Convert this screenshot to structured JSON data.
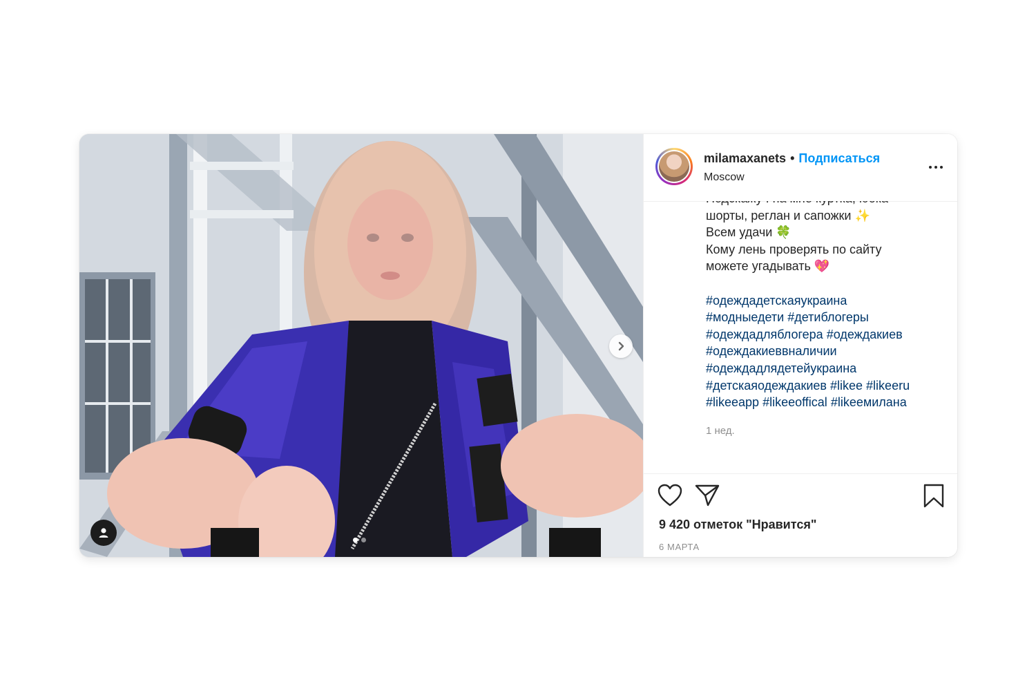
{
  "post": {
    "user": {
      "username": "milamaxanets",
      "follow_label": "Подписаться",
      "location": "Moscow",
      "separator": "•"
    },
    "caption_lines": [
      "Подскажу : на мне куртка, юбка",
      "шорты, реглан и сапожки ✨",
      "Всем удачи 🍀",
      "Кому лень проверять по сайту",
      "можете угадывать 💖"
    ],
    "hashtag_lines": [
      [
        "#одеждадетскаяукраина"
      ],
      [
        "#модныедети",
        "#детиблогеры"
      ],
      [
        "#одеждадляблогера",
        "#одеждакиев"
      ],
      [
        "#одеждакиеввналичии"
      ],
      [
        "#одеждадлядетейукраина"
      ],
      [
        "#детскаяодеждакиев",
        "#likee",
        "#likeeru"
      ],
      [
        "#likeeapp",
        "#likeeoffical",
        "#likeeмилана"
      ]
    ],
    "time_ago": "1 нед.",
    "likes": "9 420 отметок \"Нравится\"",
    "date": "6 МАРТА",
    "carousel": {
      "total": 2,
      "active": 1
    }
  },
  "icons": {
    "like": "heart-icon",
    "share": "paper-plane-icon",
    "save": "bookmark-icon",
    "more": "more-options-icon",
    "next": "chevron-right-icon",
    "tags": "user-tag-icon"
  },
  "colors": {
    "follow": "#0095f6",
    "hashtag": "#00376b",
    "text": "#262626",
    "muted": "#8e8e8e"
  }
}
